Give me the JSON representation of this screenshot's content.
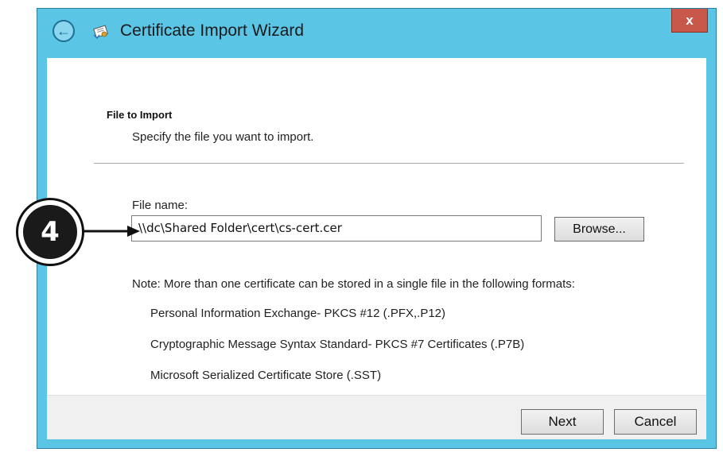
{
  "window": {
    "title": "Certificate Import Wizard",
    "close_label": "x",
    "back_glyph": "←"
  },
  "icons": {
    "back": "back-arrow-icon",
    "wizard": "certificate-icon",
    "close": "close-icon"
  },
  "section": {
    "heading": "File to Import",
    "description": "Specify the file you want to import."
  },
  "file": {
    "label": "File name:",
    "value": "\\\\dc\\Shared Folder\\cert\\cs-cert.cer",
    "browse_label": "Browse..."
  },
  "note": {
    "text": "Note:  More than one certificate can be stored in a single file in the following formats:",
    "formats": [
      "Personal Information Exchange- PKCS #12 (.PFX,.P12)",
      "Cryptographic Message Syntax Standard- PKCS #7 Certificates (.P7B)",
      "Microsoft Serialized Certificate Store (.SST)"
    ]
  },
  "footer": {
    "next_label": "Next",
    "cancel_label": "Cancel"
  },
  "callout": {
    "number": "4"
  },
  "colors": {
    "title_bar": "#5bc5e6",
    "close_button": "#c7584a",
    "content_bg": "#ffffff",
    "footer_bg": "#f0f0f0"
  }
}
